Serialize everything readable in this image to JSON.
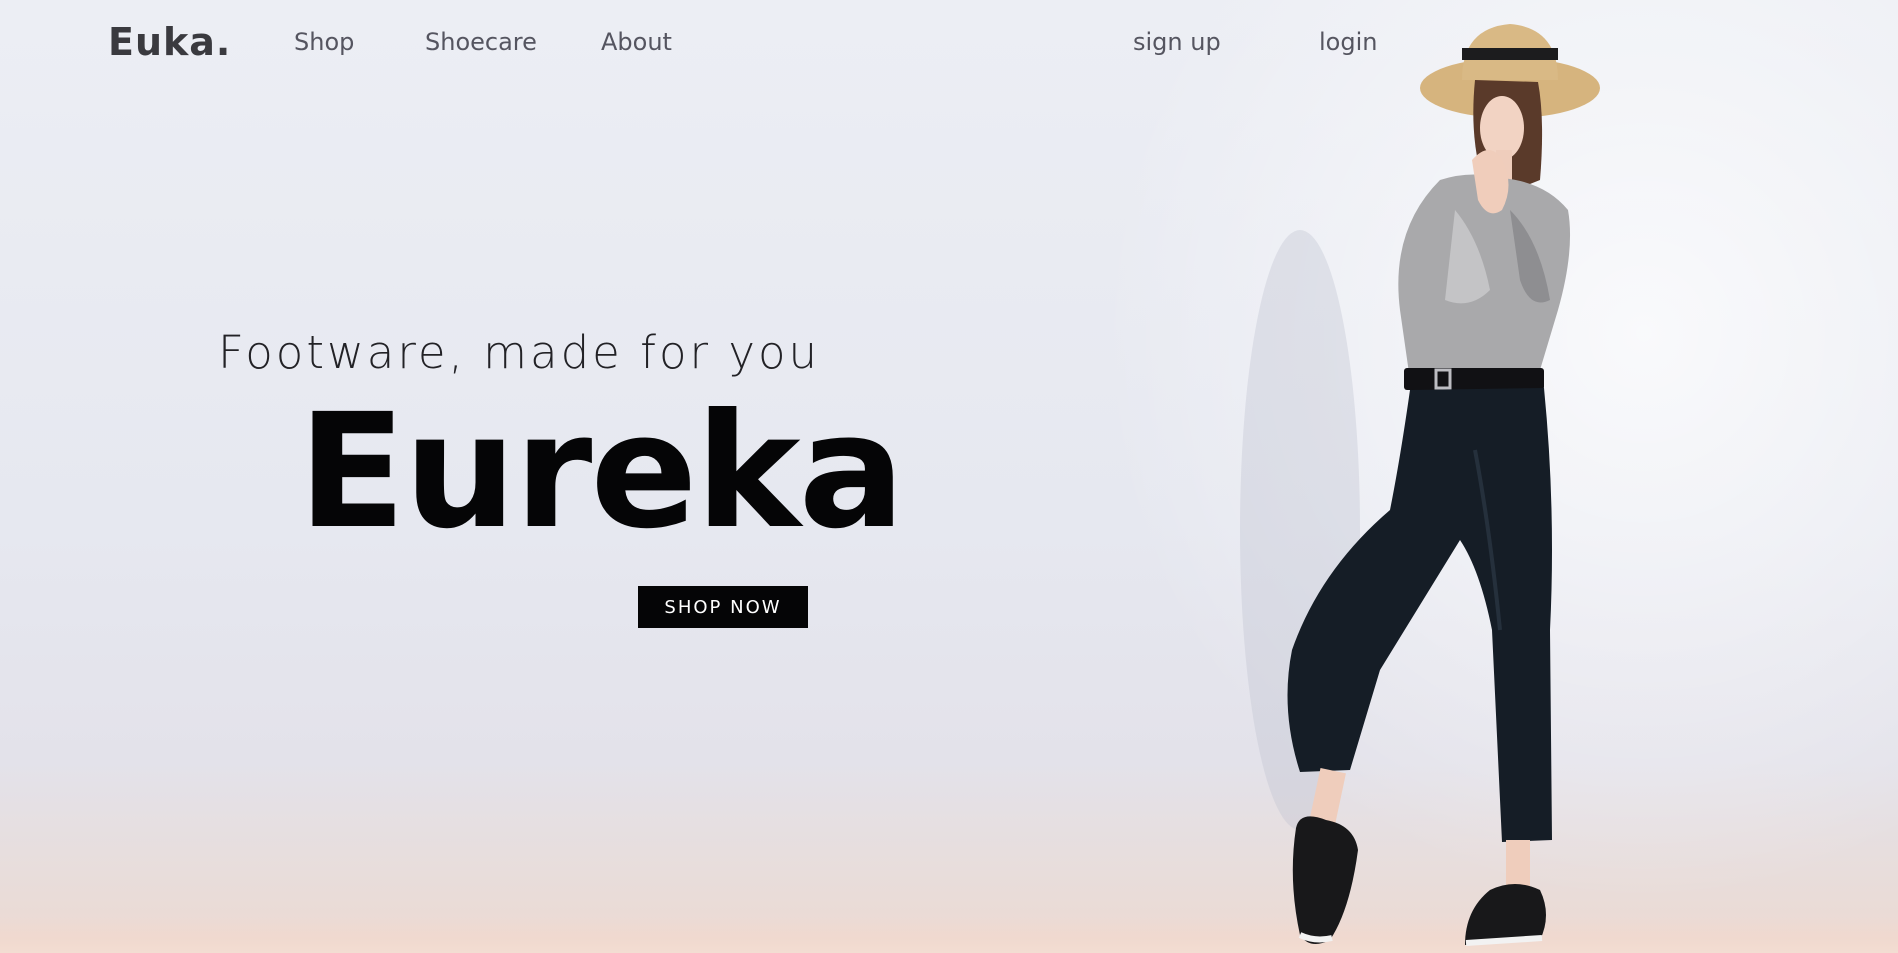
{
  "brand": {
    "logo_text": "Euka."
  },
  "nav": {
    "items": [
      {
        "label": "Shop"
      },
      {
        "label": "Shoecare"
      },
      {
        "label": "About"
      }
    ],
    "auth": {
      "signup_label": "sign up",
      "login_label": "login"
    }
  },
  "hero": {
    "tagline": "Footware, made for you",
    "title": "Eureka",
    "cta_label": "SHOP NOW",
    "image_icon": "fashion-model-illustration"
  },
  "colors": {
    "background": "#eceef4",
    "text_dark": "#050506",
    "nav_text": "#555560",
    "button_bg": "#050506",
    "button_text": "#ffffff"
  }
}
